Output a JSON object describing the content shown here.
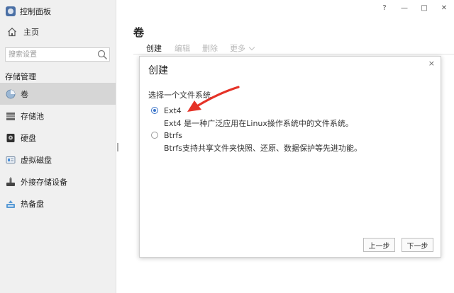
{
  "app": {
    "title": "控制面板"
  },
  "window_buttons": {
    "help": "?",
    "minimize": "—",
    "maximize": "□",
    "close": "✕"
  },
  "sidebar": {
    "home_label": "主页",
    "search_placeholder": "搜索设置",
    "section_title": "存储管理",
    "items": [
      {
        "label": "卷",
        "icon": "volume-icon",
        "active": true
      },
      {
        "label": "存储池",
        "icon": "storage-pool-icon",
        "active": false
      },
      {
        "label": "硬盘",
        "icon": "hard-disk-icon",
        "active": false
      },
      {
        "label": "虚拟磁盘",
        "icon": "virtual-disk-icon",
        "active": false
      },
      {
        "label": "外接存储设备",
        "icon": "external-storage-icon",
        "active": false
      },
      {
        "label": "热备盘",
        "icon": "hot-spare-icon",
        "active": false
      }
    ]
  },
  "main": {
    "title": "卷",
    "toolbar": {
      "create": "创建",
      "edit": "编辑",
      "delete": "删除",
      "more": "更多"
    }
  },
  "dialog": {
    "title": "创建",
    "close": "×",
    "label": "选择一个文件系统",
    "options": [
      {
        "name": "Ext4",
        "description": "Ext4 是一种广泛应用在Linux操作系统中的文件系统。",
        "selected": true
      },
      {
        "name": "Btrfs",
        "description": "Btrfs支持共享文件夹快照、还原、数据保护等先进功能。",
        "selected": false
      }
    ],
    "buttons": {
      "prev": "上一步",
      "next": "下一步"
    }
  },
  "colors": {
    "accent": "#3b74c9",
    "annotation_arrow": "#e53227",
    "sidebar_bg": "#f0f0f0",
    "active_item_bg": "#d6d6d6"
  }
}
